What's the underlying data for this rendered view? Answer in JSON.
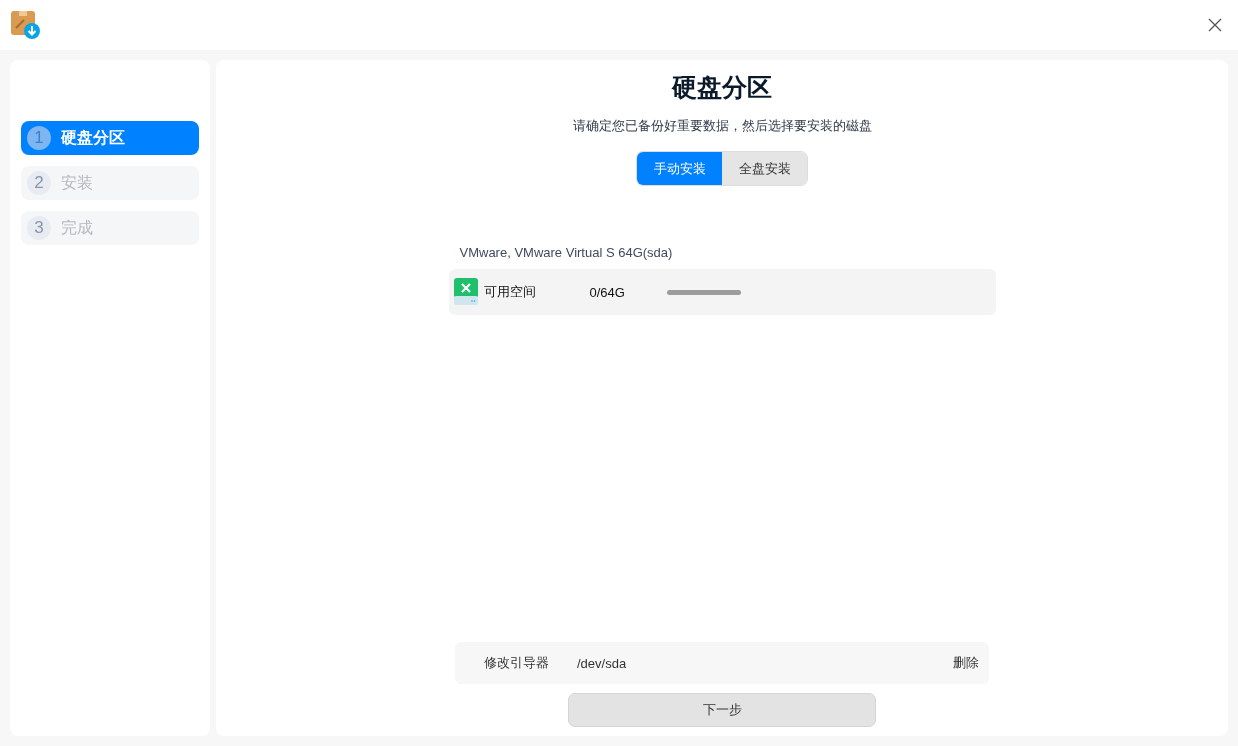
{
  "steps": [
    {
      "number": "1",
      "label": "硬盘分区",
      "selected": true
    },
    {
      "number": "2",
      "label": "安装",
      "selected": false
    },
    {
      "number": "3",
      "label": "完成",
      "selected": false
    }
  ],
  "title": "硬盘分区",
  "subtitle": "请确定您已备份好重要数据，然后选择要安装的磁盘",
  "modes": [
    {
      "label": "手动安装",
      "selected": true
    },
    {
      "label": "全盘安装",
      "selected": false
    }
  ],
  "disk": {
    "name": "VMware, VMware Virtual S 64G(sda)",
    "partitions": [
      {
        "label": "可用空间",
        "size": "0/64G"
      }
    ]
  },
  "bootloader": {
    "label": "修改引导器",
    "device": "/dev/sda",
    "action": "删除"
  },
  "next_button": "下一步"
}
